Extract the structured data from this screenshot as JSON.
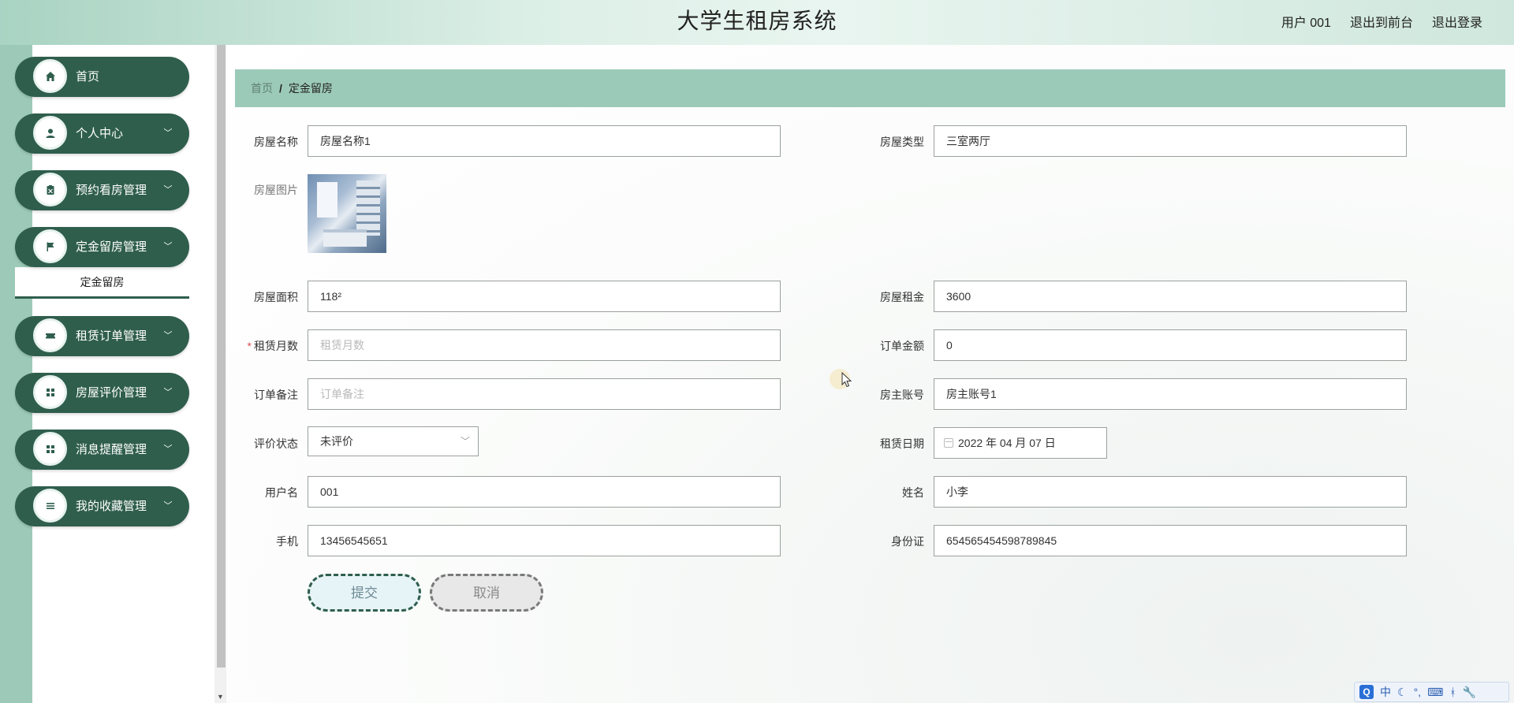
{
  "header": {
    "title": "大学生租房系统",
    "user_label": "用户 001",
    "front_link": "退出到前台",
    "logout_link": "退出登录"
  },
  "sidebar": {
    "items": [
      {
        "label": "首页",
        "icon": "home-icon"
      },
      {
        "label": "个人中心",
        "icon": "user-icon"
      },
      {
        "label": "预约看房管理",
        "icon": "clipboard-icon"
      },
      {
        "label": "定金留房管理",
        "icon": "flag-icon"
      },
      {
        "label": "租赁订单管理",
        "icon": "ticket-icon"
      },
      {
        "label": "房屋评价管理",
        "icon": "grid-icon"
      },
      {
        "label": "消息提醒管理",
        "icon": "grid-icon"
      },
      {
        "label": "我的收藏管理",
        "icon": "list-icon"
      }
    ],
    "submenu_active": "定金留房"
  },
  "breadcrumb": {
    "home": "首页",
    "separator": "/",
    "current": "定金留房"
  },
  "form": {
    "house_name": {
      "label": "房屋名称",
      "value": "房屋名称1"
    },
    "house_type": {
      "label": "房屋类型",
      "value": "三室两厅"
    },
    "house_image": {
      "label": "房屋图片"
    },
    "house_area": {
      "label": "房屋面积",
      "value": "118²"
    },
    "house_rent": {
      "label": "房屋租金",
      "value": "3600"
    },
    "lease_months": {
      "label": "租赁月数",
      "placeholder": "租赁月数",
      "required_mark": "*"
    },
    "order_amount": {
      "label": "订单金额",
      "value": "0"
    },
    "order_note": {
      "label": "订单备注",
      "placeholder": "订单备注"
    },
    "owner_account": {
      "label": "房主账号",
      "value": "房主账号1"
    },
    "review_status": {
      "label": "评价状态",
      "value": "未评价"
    },
    "lease_date": {
      "label": "租赁日期",
      "value": "2022 年 04 月 07 日"
    },
    "username": {
      "label": "用户名",
      "value": "001"
    },
    "real_name": {
      "label": "姓名",
      "value": "小李"
    },
    "phone": {
      "label": "手机",
      "value": "13456545651"
    },
    "id_card": {
      "label": "身份证",
      "value": "654565454598789845"
    },
    "submit_label": "提交",
    "cancel_label": "取消"
  },
  "ime": {
    "logo": "Q",
    "mode": "中",
    "items": [
      "☾",
      "°,",
      "⌨",
      "ᚼ",
      "🔧"
    ]
  },
  "colors": {
    "sidebar_item": "#2f5e4d",
    "breadcrumb_bg": "#9ccab9",
    "accent_strip": "#9dcab8"
  }
}
